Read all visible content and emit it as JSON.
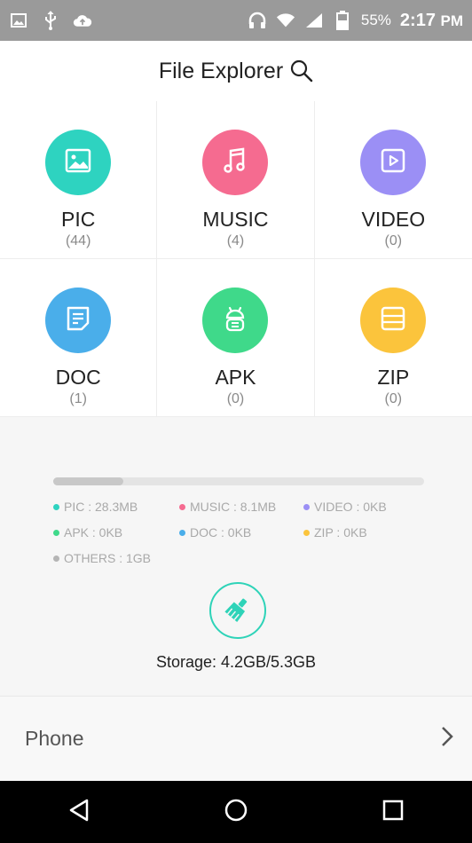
{
  "status_bar": {
    "battery_text": "55%",
    "time": "2:17",
    "time_suffix": "PM",
    "icons": [
      "image-icon",
      "usb-icon",
      "cloud-upload-icon",
      "headset-icon",
      "wifi-icon",
      "signal-icon",
      "battery-icon"
    ]
  },
  "header": {
    "title": "File Explorer",
    "search_icon": "search-icon"
  },
  "categories": [
    {
      "label": "PIC",
      "count": "(44)",
      "color": "#2ed3c0",
      "icon": "image-icon"
    },
    {
      "label": "MUSIC",
      "count": "(4)",
      "color": "#f56b90",
      "icon": "music-icon"
    },
    {
      "label": "VIDEO",
      "count": "(0)",
      "color": "#9b8ff5",
      "icon": "video-icon"
    },
    {
      "label": "DOC",
      "count": "(1)",
      "color": "#4aaeea",
      "icon": "document-icon"
    },
    {
      "label": "APK",
      "count": "(0)",
      "color": "#3fd98a",
      "icon": "android-icon"
    },
    {
      "label": "ZIP",
      "count": "(0)",
      "color": "#fbc43c",
      "icon": "archive-icon"
    }
  ],
  "storage": {
    "used_fraction": 0.19,
    "legend": [
      {
        "label": "PIC : 28.3MB",
        "color": "#2ed3c0"
      },
      {
        "label": "MUSIC : 8.1MB",
        "color": "#f56b90"
      },
      {
        "label": "VIDEO : 0KB",
        "color": "#9b8ff5"
      },
      {
        "label": "APK : 0KB",
        "color": "#3fd98a"
      },
      {
        "label": "DOC : 0KB",
        "color": "#4aaeea"
      },
      {
        "label": "ZIP : 0KB",
        "color": "#fbc43c"
      },
      {
        "label": "OTHERS : 1GB",
        "color": "#b5b5b5"
      }
    ],
    "clean_icon": "broom-icon",
    "summary": "Storage: 4.2GB/5.3GB"
  },
  "phone_row": {
    "label": "Phone",
    "icon": "chevron-right-icon"
  },
  "nav_bar": {
    "icons": [
      "back-icon",
      "home-icon",
      "recents-icon"
    ]
  }
}
